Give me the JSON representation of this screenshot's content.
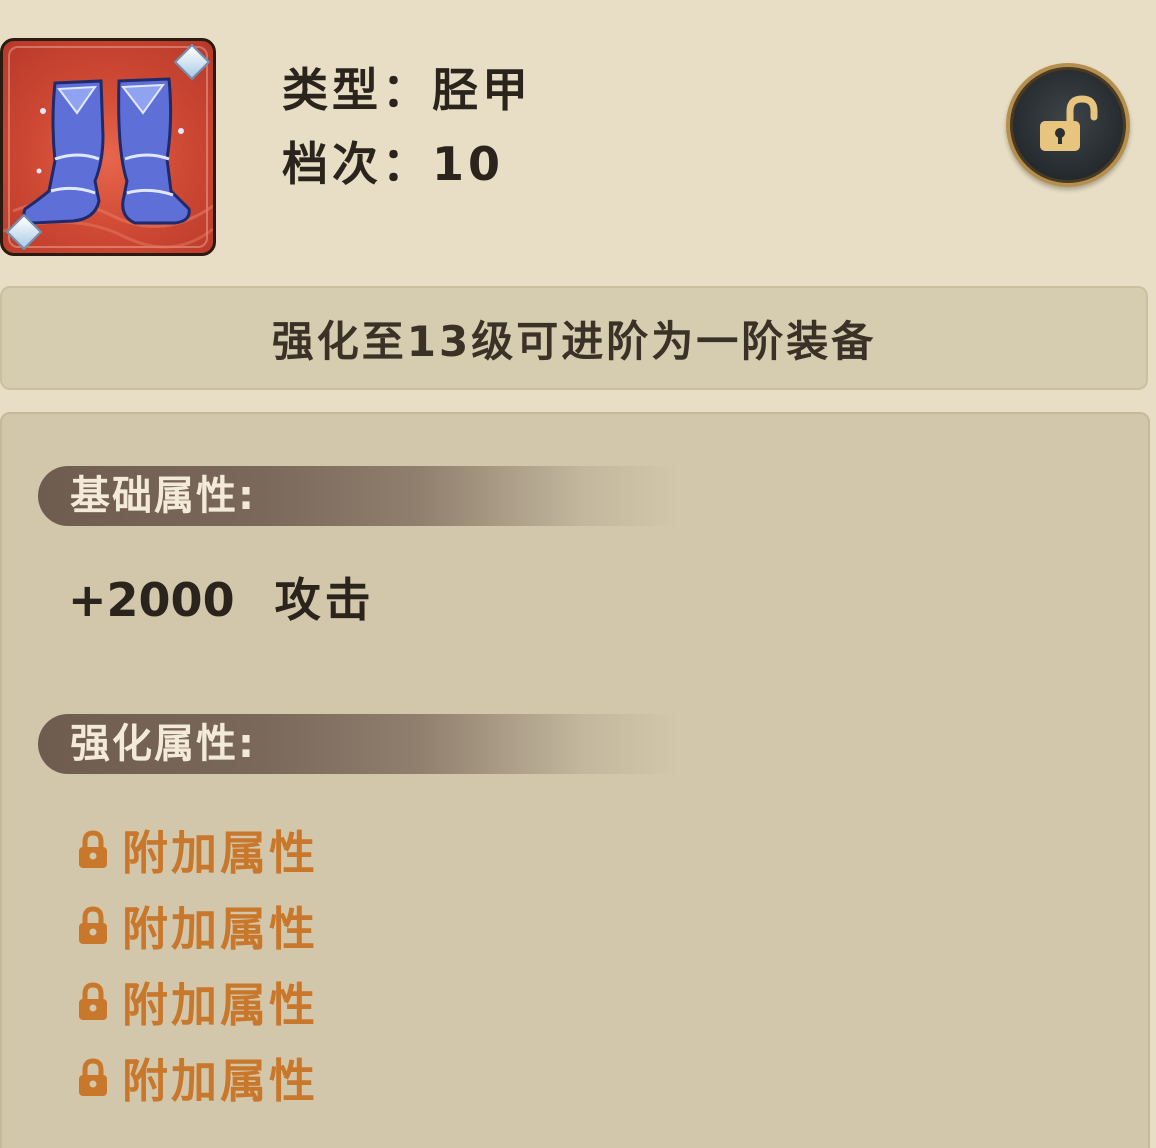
{
  "item": {
    "icon": "greaves-boots-icon",
    "type_line": "类型：胫甲",
    "tier_line": "档次：10"
  },
  "lock_button": {
    "icon": "unlock-padlock-icon",
    "state": "unlocked"
  },
  "notice": "强化至13级可进阶为一阶装备",
  "base_section": {
    "title": "基础属性:",
    "value": "+2000",
    "stat": "攻击"
  },
  "enhance_section": {
    "title": "强化属性:",
    "rows": [
      {
        "icon": "padlock-icon",
        "label": "附加属性"
      },
      {
        "icon": "padlock-icon",
        "label": "附加属性"
      },
      {
        "icon": "padlock-icon",
        "label": "附加属性"
      },
      {
        "icon": "padlock-icon",
        "label": "附加属性"
      }
    ]
  },
  "colors": {
    "background": "#e7dec5",
    "panel": "#d2c7aa",
    "locked_text": "#c8772b",
    "icon_frame": "#d04a34",
    "lock_ring": "#b58f4d"
  }
}
